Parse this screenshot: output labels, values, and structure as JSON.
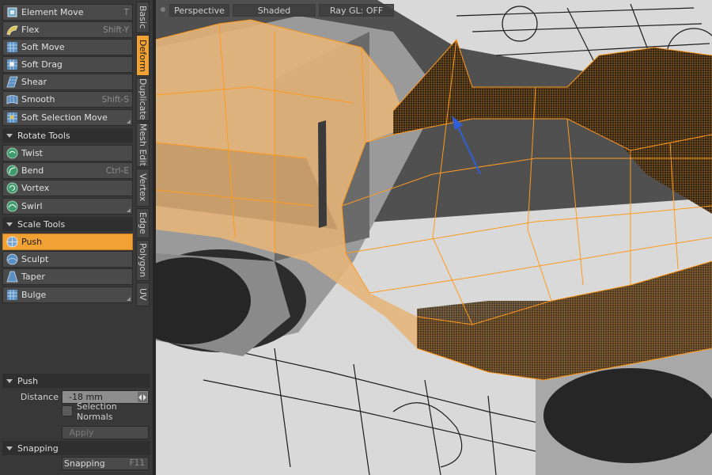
{
  "deform_tools": [
    {
      "label": "Element Move",
      "shortcut": "T",
      "icon": "element-move-icon"
    },
    {
      "label": "Flex",
      "shortcut": "Shift-Y",
      "icon": "flex-icon"
    },
    {
      "label": "Soft Move",
      "shortcut": "",
      "icon": "soft-move-icon"
    },
    {
      "label": "Soft Drag",
      "shortcut": "",
      "icon": "soft-drag-icon"
    },
    {
      "label": "Shear",
      "shortcut": "",
      "icon": "shear-icon"
    },
    {
      "label": "Smooth",
      "shortcut": "Shift-S",
      "icon": "smooth-icon"
    },
    {
      "label": "Soft Selection Move",
      "shortcut": "",
      "icon": "soft-selection-move-icon"
    }
  ],
  "rotate_section": {
    "title": "Rotate Tools"
  },
  "rotate_tools": [
    {
      "label": "Twist",
      "shortcut": "",
      "icon": "twist-icon"
    },
    {
      "label": "Bend",
      "shortcut": "Ctrl-E",
      "icon": "bend-icon"
    },
    {
      "label": "Vortex",
      "shortcut": "",
      "icon": "vortex-icon"
    },
    {
      "label": "Swirl",
      "shortcut": "",
      "icon": "swirl-icon"
    }
  ],
  "scale_section": {
    "title": "Scale Tools"
  },
  "scale_tools": [
    {
      "label": "Push",
      "shortcut": "",
      "icon": "push-icon",
      "active": true
    },
    {
      "label": "Sculpt",
      "shortcut": "",
      "icon": "sculpt-icon"
    },
    {
      "label": "Taper",
      "shortcut": "",
      "icon": "taper-icon"
    },
    {
      "label": "Bulge",
      "shortcut": "",
      "icon": "bulge-icon"
    }
  ],
  "vertical_tabs": [
    {
      "label": "Basic"
    },
    {
      "label": "Deform",
      "active": true
    },
    {
      "label": "Duplicate"
    },
    {
      "label": "Mesh Edit"
    },
    {
      "label": "Vertex"
    },
    {
      "label": "Edge"
    },
    {
      "label": "Polygon"
    },
    {
      "label": "UV"
    }
  ],
  "properties": {
    "title": "Push",
    "distance_label": "Distance",
    "distance_value": "-18 mm",
    "selection_normals_label": "Selection Normals",
    "selection_normals_checked": false,
    "apply_label": "Apply"
  },
  "snapping": {
    "title": "Snapping",
    "button_label": "Snapping",
    "shortcut": "F11"
  },
  "viewport": {
    "view_label": "Perspective",
    "shading_label": "Shaded",
    "raygl_label": "Ray GL: OFF"
  },
  "colors": {
    "accent": "#f2a134",
    "mesh_fill": "#e6b57a",
    "wireframe": "#ff9a1f",
    "widget": "#2f5fd8"
  }
}
